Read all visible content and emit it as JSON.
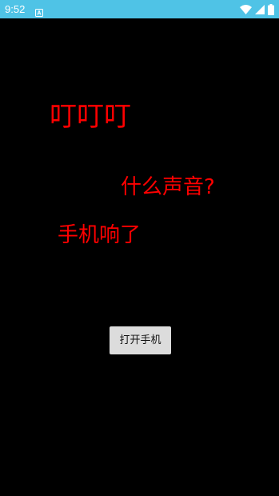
{
  "status_bar": {
    "time": "9:52",
    "background": "#4fc3e6",
    "icons": [
      "notification-a-icon",
      "wifi-icon",
      "signal-icon",
      "battery-icon"
    ]
  },
  "main": {
    "line1": "叮叮叮",
    "line2": "什么声音?",
    "line3": "手机响了",
    "text_color": "#ff0000",
    "button_label": "打开手机"
  }
}
